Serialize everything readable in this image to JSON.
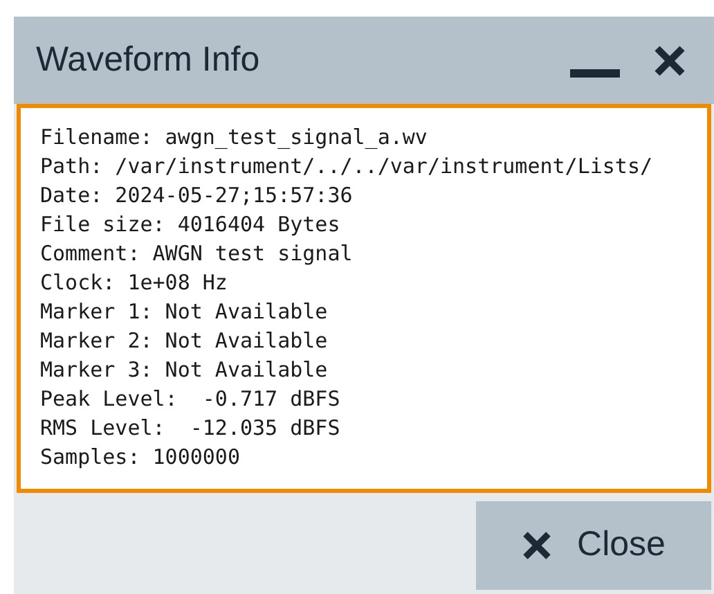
{
  "window": {
    "title": "Waveform Info"
  },
  "info_lines": [
    "Filename: awgn_test_signal_a.wv",
    "Path: /var/instrument/../../var/instrument/Lists/",
    "Date: 2024-05-27;15:57:36",
    "File size: 4016404 Bytes",
    "Comment: AWGN test signal",
    "Clock: 1e+08 Hz",
    "Marker 1: Not Available",
    "Marker 2: Not Available",
    "Marker 3: Not Available",
    "Peak Level:  -0.717 dBFS",
    "RMS Level:  -12.035 dBFS",
    "Samples: 1000000"
  ],
  "close_button": {
    "label": "Close"
  }
}
